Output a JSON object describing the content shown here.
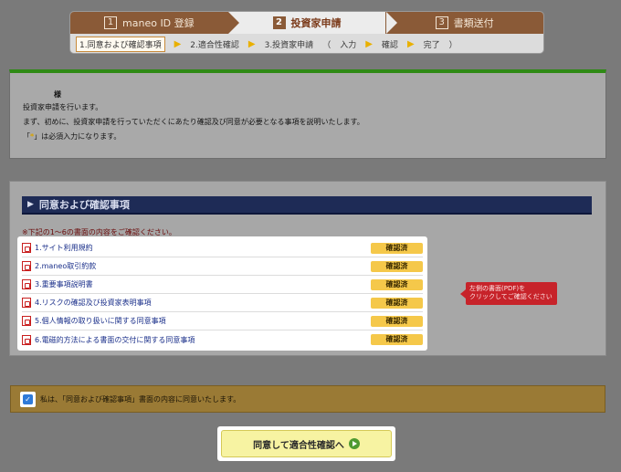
{
  "steps": [
    {
      "num": "1",
      "label": "maneo ID 登録"
    },
    {
      "num": "2",
      "label": "投資家申請"
    },
    {
      "num": "3",
      "label": "書類送付"
    }
  ],
  "substeps": {
    "s1": "1.同意および確認事項",
    "s2": "2.適合性確認",
    "s3": "3.投資家申請",
    "paren_open": "（",
    "input": "入力",
    "confirm": "確認",
    "done": "完了",
    "paren_close": "）"
  },
  "intro": {
    "honorific": "様",
    "line1": "投資家申請を行います。",
    "line2": "まず、初めに、投資家申請を行っていただくにあたり確認及び同意が必要となる事項を説明いたします。",
    "line3_prefix": "「",
    "required_mark": "*",
    "line3_suffix": "」は必須入力になります。"
  },
  "section": {
    "title": "同意および確認事項",
    "notice": "※下記の1〜6の書面の内容をご確認ください。"
  },
  "documents": [
    {
      "label": "1.サイト利用規約",
      "status": "確認済"
    },
    {
      "label": "2.maneo取引約款",
      "status": "確認済"
    },
    {
      "label": "3.重要事項説明書",
      "status": "確認済"
    },
    {
      "label": "4.リスクの確認及び投資家表明事項",
      "status": "確認済"
    },
    {
      "label": "5.個人情報の取り扱いに関する同意事項",
      "status": "確認済"
    },
    {
      "label": "6.電磁的方法による書面の交付に関する同意事項",
      "status": "確認済"
    }
  ],
  "tooltip": {
    "line1": "左側の書面(PDF)を",
    "line2": "クリックしてご確認ください"
  },
  "agreement": {
    "checked": true,
    "label": "私は、「同意および確認事項」書面の内容に同意いたします。"
  },
  "submit": {
    "label": "同意して適合性確認へ"
  },
  "colors": {
    "navy_bar": "#1e2b56",
    "green_accent": "#2f8a15",
    "step_brown": "#8a5a37",
    "badge_yellow": "#f5c84a",
    "tooltip_red": "#c7232a"
  }
}
